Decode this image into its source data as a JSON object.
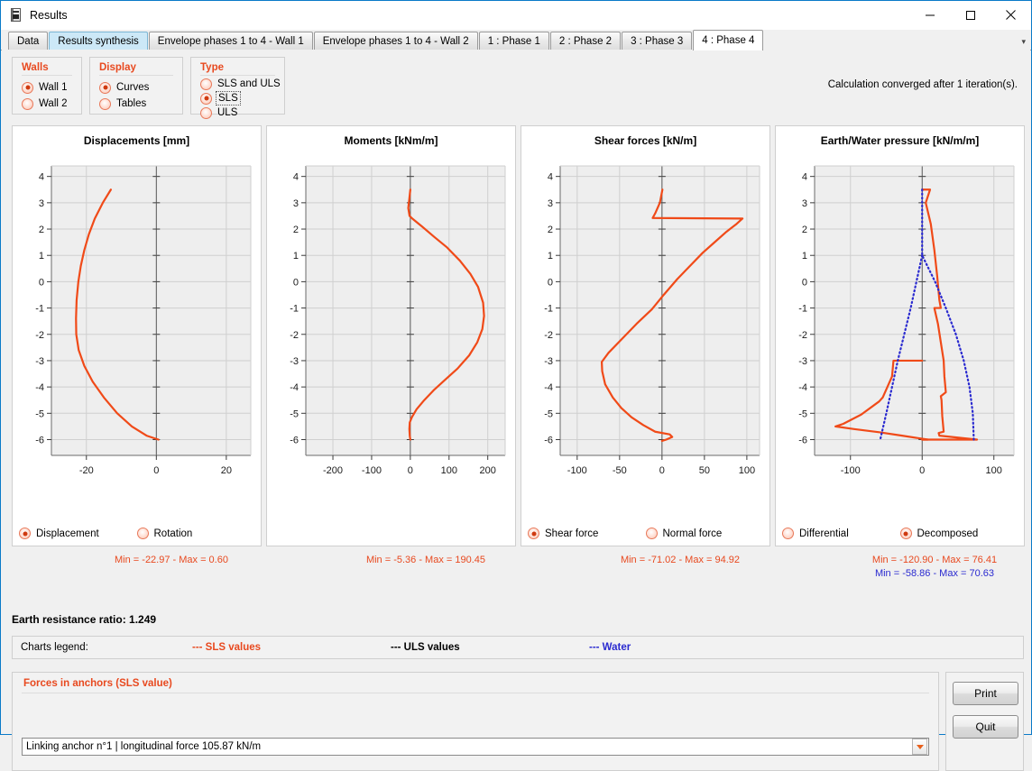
{
  "window": {
    "title": "Results",
    "icon": "document-icon",
    "minimize_label": "minimize-icon",
    "maximize_label": "maximize-icon",
    "close_label": "close-icon"
  },
  "tabs": [
    {
      "label": "Data",
      "state": "normal"
    },
    {
      "label": "Results synthesis",
      "state": "highlighted"
    },
    {
      "label": "Envelope phases 1 to 4 - Wall 1",
      "state": "normal"
    },
    {
      "label": "Envelope phases 1 to 4 - Wall 2",
      "state": "normal"
    },
    {
      "label": "1 : Phase 1",
      "state": "normal"
    },
    {
      "label": "2 : Phase 2",
      "state": "normal"
    },
    {
      "label": "3 : Phase 3",
      "state": "normal"
    },
    {
      "label": "4 : Phase 4",
      "state": "active"
    }
  ],
  "options": {
    "walls": {
      "title": "Walls",
      "items": [
        {
          "label": "Wall 1",
          "selected": true
        },
        {
          "label": "Wall 2",
          "selected": false
        }
      ]
    },
    "display": {
      "title": "Display",
      "items": [
        {
          "label": "Curves",
          "selected": true
        },
        {
          "label": "Tables",
          "selected": false
        }
      ]
    },
    "type": {
      "title": "Type",
      "items": [
        {
          "label": "SLS and ULS",
          "selected": false,
          "focused": false
        },
        {
          "label": "SLS",
          "selected": true,
          "focused": true
        },
        {
          "label": "ULS",
          "selected": false,
          "focused": false
        }
      ]
    }
  },
  "status": {
    "converged_message": "Calculation converged after  1 iteration(s)."
  },
  "minmax": [
    {
      "text": "Min = -22.97  -  Max = 0.60",
      "color": "#e8491f"
    },
    {
      "text": "Min = -5.36  -  Max = 190.45",
      "color": "#e8491f"
    },
    {
      "text": "Min = -71.02  -  Max = 94.92",
      "color": "#e8491f"
    },
    {
      "text": "Min = -120.90  -  Max = 76.41",
      "color": "#e8491f"
    },
    {
      "text": "Min = -58.86  -  Max = 70.63",
      "color": "#2a2ad0"
    }
  ],
  "earth_resistance": {
    "label": "Earth resistance ratio: 1.249"
  },
  "charts_legend": {
    "label": "Charts legend:",
    "items": [
      {
        "text": "--- SLS values",
        "color": "#e8491f"
      },
      {
        "text": "--- ULS values",
        "color": "#000000"
      },
      {
        "text": "--- Water",
        "color": "#2a2ad0"
      }
    ]
  },
  "anchors": {
    "title": "Forces in anchors (SLS value)",
    "selected_option": "Linking anchor n°1 | longitudinal force 105.87 kN/m",
    "dropdown_icon": "chevron-down-icon"
  },
  "buttons": {
    "print": "Print",
    "quit": "Quit"
  },
  "chart_data": [
    {
      "type": "line",
      "title": "Displacements [mm]",
      "xlabel": "",
      "ylabel": "",
      "xlim": [
        -30,
        27
      ],
      "ylim": [
        -6.6,
        4.4
      ],
      "xticks": [
        -20,
        0,
        20
      ],
      "yticks": [
        4,
        3,
        2,
        1,
        0,
        -1,
        -2,
        -3,
        -4,
        -5,
        -6
      ],
      "grid": true,
      "legend_position": "bottom",
      "legend": [
        {
          "label": "Displacement",
          "selected": true
        },
        {
          "label": "Rotation",
          "selected": false
        }
      ],
      "series": [
        {
          "name": "Displacement",
          "color": "#f04a18",
          "style": "solid",
          "points": [
            [
              -13.0,
              3.5
            ],
            [
              -15.3,
              3.0
            ],
            [
              -17.6,
              2.4
            ],
            [
              -19.3,
              1.8
            ],
            [
              -20.6,
              1.2
            ],
            [
              -21.6,
              0.6
            ],
            [
              -22.3,
              0.0
            ],
            [
              -22.8,
              -0.7
            ],
            [
              -22.97,
              -1.4
            ],
            [
              -22.9,
              -2.0
            ],
            [
              -22.2,
              -2.6
            ],
            [
              -20.6,
              -3.2
            ],
            [
              -18.2,
              -3.8
            ],
            [
              -15.0,
              -4.4
            ],
            [
              -11.2,
              -5.0
            ],
            [
              -7.0,
              -5.5
            ],
            [
              -2.8,
              -5.85
            ],
            [
              0.6,
              -6.0
            ]
          ]
        }
      ]
    },
    {
      "type": "line",
      "title": "Moments [kNm/m]",
      "xlabel": "",
      "ylabel": "",
      "xlim": [
        -270,
        245
      ],
      "ylim": [
        -6.6,
        4.4
      ],
      "xticks": [
        -200,
        -100,
        0,
        100,
        200
      ],
      "yticks": [
        4,
        3,
        2,
        1,
        0,
        -1,
        -2,
        -3,
        -4,
        -5,
        -6
      ],
      "grid": true,
      "legend_position": "none",
      "legend": [],
      "series": [
        {
          "name": "Moments",
          "color": "#f04a18",
          "style": "solid",
          "points": [
            [
              0.0,
              3.5
            ],
            [
              -3.0,
              3.1
            ],
            [
              -5.36,
              2.8
            ],
            [
              -2.0,
              2.5
            ],
            [
              5.0,
              2.4
            ],
            [
              30.0,
              2.1
            ],
            [
              62.0,
              1.7
            ],
            [
              95.0,
              1.3
            ],
            [
              128.0,
              0.8
            ],
            [
              155.0,
              0.3
            ],
            [
              175.0,
              -0.2
            ],
            [
              188.0,
              -0.8
            ],
            [
              190.45,
              -1.3
            ],
            [
              186.0,
              -1.8
            ],
            [
              173.0,
              -2.3
            ],
            [
              152.0,
              -2.8
            ],
            [
              122.0,
              -3.3
            ],
            [
              92.0,
              -3.7
            ],
            [
              62.0,
              -4.1
            ],
            [
              36.0,
              -4.5
            ],
            [
              16.0,
              -4.85
            ],
            [
              4.0,
              -5.15
            ],
            [
              -1.5,
              -5.35
            ],
            [
              -2.5,
              -5.6
            ],
            [
              -1.5,
              -5.85
            ],
            [
              0.0,
              -6.0
            ]
          ]
        }
      ]
    },
    {
      "type": "line",
      "title": "Shear forces [kN/m]",
      "xlabel": "",
      "ylabel": "",
      "xlim": [
        -120,
        115
      ],
      "ylim": [
        -6.6,
        4.4
      ],
      "xticks": [
        -100,
        -50,
        0,
        50,
        100
      ],
      "yticks": [
        4,
        3,
        2,
        1,
        0,
        -1,
        -2,
        -3,
        -4,
        -5,
        -6
      ],
      "grid": true,
      "legend_position": "bottom",
      "legend": [
        {
          "label": "Shear force",
          "selected": true
        },
        {
          "label": "Normal force",
          "selected": false
        }
      ],
      "series": [
        {
          "name": "Shear force",
          "color": "#f04a18",
          "style": "solid",
          "points": [
            [
              0.5,
              3.5
            ],
            [
              -2.5,
              3.0
            ],
            [
              -8.0,
              2.6
            ],
            [
              -11.0,
              2.42
            ],
            [
              94.92,
              2.4
            ],
            [
              88.0,
              2.2
            ],
            [
              76.0,
              1.9
            ],
            [
              62.0,
              1.5
            ],
            [
              48.0,
              1.1
            ],
            [
              33.0,
              0.6
            ],
            [
              18.0,
              0.1
            ],
            [
              2.0,
              -0.5
            ],
            [
              -12.0,
              -1.05
            ],
            [
              -30.0,
              -1.6
            ],
            [
              -48.0,
              -2.2
            ],
            [
              -63.0,
              -2.7
            ],
            [
              -71.02,
              -3.05
            ],
            [
              -70.5,
              -3.4
            ],
            [
              -67.0,
              -3.9
            ],
            [
              -58.0,
              -4.4
            ],
            [
              -48.0,
              -4.8
            ],
            [
              -36.0,
              -5.15
            ],
            [
              -22.0,
              -5.45
            ],
            [
              -8.0,
              -5.7
            ],
            [
              9.0,
              -5.8
            ],
            [
              12.0,
              -5.9
            ],
            [
              5.0,
              -6.0
            ],
            [
              0.0,
              -6.05
            ]
          ]
        }
      ]
    },
    {
      "type": "line",
      "title": "Earth/Water pressure [kN/m/m]",
      "xlabel": "",
      "ylabel": "",
      "xlim": [
        -150,
        128
      ],
      "ylim": [
        -6.6,
        4.4
      ],
      "xticks": [
        -100,
        0,
        100
      ],
      "yticks": [
        4,
        3,
        2,
        1,
        0,
        -1,
        -2,
        -3,
        -4,
        -5,
        -6
      ],
      "grid": true,
      "legend_position": "bottom",
      "legend": [
        {
          "label": "Differential",
          "selected": false
        },
        {
          "label": "Decomposed",
          "selected": true
        }
      ],
      "series": [
        {
          "name": "Decomposed right",
          "color": "#f04a18",
          "style": "solid",
          "points": [
            [
              0.0,
              3.5
            ],
            [
              11.0,
              3.5
            ],
            [
              5.0,
              3.0
            ],
            [
              12.0,
              2.2
            ],
            [
              17.0,
              1.2
            ],
            [
              21.0,
              0.2
            ],
            [
              24.0,
              -0.7
            ],
            [
              26.0,
              -1.0
            ],
            [
              17.0,
              -1.0
            ],
            [
              22.0,
              -1.6
            ],
            [
              26.0,
              -2.3
            ],
            [
              30.0,
              -3.0
            ],
            [
              31.0,
              -3.6
            ],
            [
              33.0,
              -4.2
            ],
            [
              26.0,
              -4.35
            ],
            [
              27.0,
              -4.5
            ],
            [
              28.0,
              -5.1
            ],
            [
              30.0,
              -5.7
            ],
            [
              23.0,
              -5.75
            ],
            [
              24.0,
              -5.85
            ],
            [
              76.41,
              -6.0
            ],
            [
              0.0,
              -6.0
            ]
          ]
        },
        {
          "name": "Decomposed left",
          "color": "#f04a18",
          "style": "solid",
          "points": [
            [
              0.0,
              -3.0
            ],
            [
              -40.0,
              -3.0
            ],
            [
              -42.0,
              -3.6
            ],
            [
              -55.0,
              -4.4
            ],
            [
              -60.0,
              -4.55
            ],
            [
              -85.0,
              -5.05
            ],
            [
              -110.0,
              -5.4
            ],
            [
              -120.9,
              -5.5
            ],
            [
              -95.0,
              -5.6
            ],
            [
              -60.0,
              -5.72
            ],
            [
              -28.0,
              -5.85
            ],
            [
              8.0,
              -6.0
            ],
            [
              0.0,
              -6.0
            ]
          ]
        },
        {
          "name": "Water",
          "color": "#2a2ad0",
          "style": "dotted",
          "points": [
            [
              0.0,
              3.5
            ],
            [
              0.0,
              1.0
            ],
            [
              18.0,
              0.0
            ],
            [
              33.0,
              -1.0
            ],
            [
              47.0,
              -2.0
            ],
            [
              58.0,
              -3.0
            ],
            [
              66.0,
              -4.0
            ],
            [
              70.63,
              -5.0
            ],
            [
              72.0,
              -6.0
            ]
          ]
        },
        {
          "name": "Water left",
          "color": "#2a2ad0",
          "style": "dotted",
          "points": [
            [
              0.0,
              1.0
            ],
            [
              -8.0,
              0.0
            ],
            [
              -16.0,
              -1.0
            ],
            [
              -25.0,
              -2.0
            ],
            [
              -34.0,
              -3.0
            ],
            [
              -42.0,
              -4.0
            ],
            [
              -50.0,
              -5.0
            ],
            [
              -58.86,
              -6.05
            ]
          ]
        }
      ]
    }
  ]
}
